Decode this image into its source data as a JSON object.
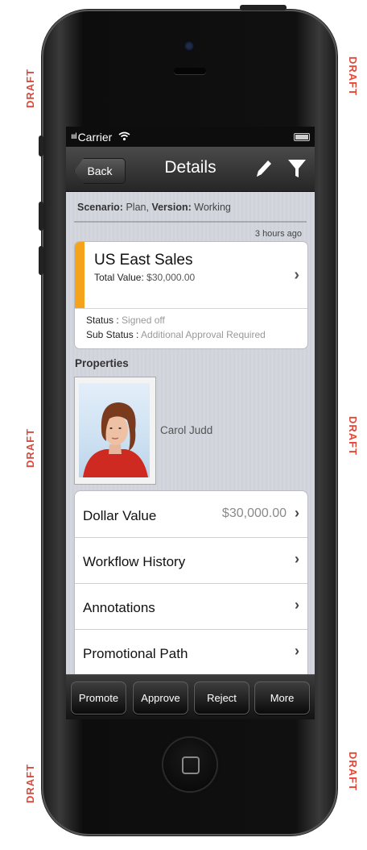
{
  "watermark": "DRAFT",
  "status_bar": {
    "signal": "ıııl",
    "carrier": "Carrier"
  },
  "nav": {
    "back_label": "Back",
    "title": "Details"
  },
  "scenario": {
    "scenario_label": "Scenario:",
    "scenario_value": "Plan,",
    "version_label": "Version:",
    "version_value": "Working"
  },
  "timestamp": "3 hours ago",
  "summary_card": {
    "title": "US East Sales",
    "total_value_label": "Total Value:",
    "total_value": "$30,000.00",
    "status_label": "Status :",
    "status_value": "Signed off",
    "sub_status_label": "Sub Status :",
    "sub_status_value": "Additional Approval Required",
    "accent_color": "#f5a31a"
  },
  "properties": {
    "heading": "Properties",
    "person_name": "Carol Judd"
  },
  "detail_rows": [
    {
      "label": "Dollar Value",
      "value": "$30,000.00"
    },
    {
      "label": "Workflow History",
      "value": ""
    },
    {
      "label": "Annotations",
      "value": ""
    },
    {
      "label": "Promotional Path",
      "value": ""
    }
  ],
  "toolbar": {
    "promote": "Promote",
    "approve": "Approve",
    "reject": "Reject",
    "more": "More"
  },
  "icons": [
    "wifi-icon",
    "battery-icon",
    "pencil-icon",
    "filter-icon",
    "chevron-right-icon",
    "home-button-icon"
  ]
}
